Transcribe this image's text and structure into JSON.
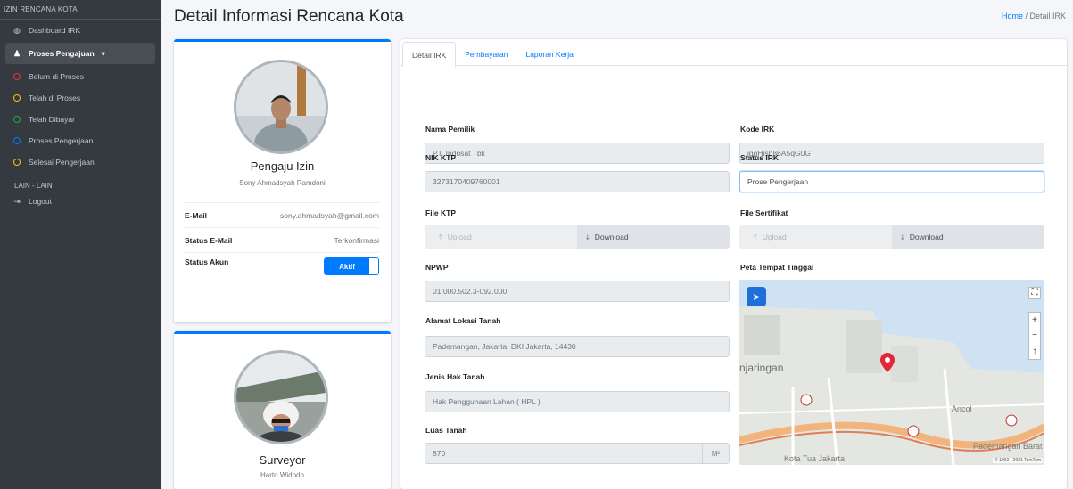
{
  "sidebar": {
    "brand": "IZIN RENCANA KOTA",
    "items": [
      {
        "label": "Dashboard IRK",
        "icon": "dashboard-icon"
      },
      {
        "label": "Proses Pengajuan",
        "icon": "user-icon"
      },
      {
        "label": "Belum di Proses",
        "color": "#dc3545"
      },
      {
        "label": "Telah di Proses",
        "color": "#ffc107"
      },
      {
        "label": "Telah Dibayar",
        "color": "#28a745"
      },
      {
        "label": "Proses Pengerjaan",
        "color": "#007bff"
      },
      {
        "label": "Selesai Pengerjaan",
        "color": "#ffc107"
      }
    ],
    "section": "LAIN - LAIN",
    "logout": "Logout"
  },
  "header": {
    "title": "Detail Informasi Rencana Kota",
    "breadcrumb_home": "Home",
    "breadcrumb_sep": " / ",
    "breadcrumb_current": "Detail IRK"
  },
  "applicant": {
    "role": "Pengaju Izin",
    "name": "Sony Ahmadsyah Ramdoni",
    "rows": [
      {
        "label": "E-Mail",
        "value": "sony.ahmadsyah@gmail.com"
      },
      {
        "label": "Status E-Mail",
        "value": "Terkonfirmasi"
      },
      {
        "label": "Status Akun",
        "value": "Aktif"
      }
    ]
  },
  "surveyor": {
    "role": "Surveyor",
    "name": "Harto Widodo"
  },
  "tabs": [
    "Detail IRK",
    "Pembayaran",
    "Laporan Kerja"
  ],
  "form": {
    "nama_pemilik": {
      "label": "Nama Pemilik",
      "value": "PT. Indosat Tbk"
    },
    "kode_irk": {
      "label": "Kode IRK",
      "value": "jgqHish86A5qG0G"
    },
    "nik_ktp": {
      "label": "NIK KTP",
      "value": "3273170409760001"
    },
    "status_irk": {
      "label": "Status IRK",
      "value": "Prose Pengerjaan"
    },
    "file_ktp": {
      "label": "File KTP",
      "upload": "Upload",
      "download": "Download"
    },
    "file_sertifikat": {
      "label": "File Sertifikat",
      "upload": "Upload",
      "download": "Download"
    },
    "npwp": {
      "label": "NPWP",
      "value": "01.000.502.3-092.000"
    },
    "peta": {
      "label": "Peta Tempat Tinggal"
    },
    "alamat": {
      "label": "Alamat Lokasi Tanah",
      "value": "Pademangan, Jakarta, DKI Jakarta, 14430"
    },
    "jenis_hak": {
      "label": "Jenis Hak Tanah",
      "value": "Hak Penggunaan Lahan ( HPL )"
    },
    "luas": {
      "label": "Luas Tanah",
      "value": "870",
      "unit": "M²"
    }
  },
  "map": {
    "place1": "njaringan",
    "place2": "Ancol",
    "place3": "Pademangan Barat",
    "place4": "Kota Tua Jakarta",
    "attribution": "© 1992 - 2021 TomTom"
  },
  "colors": {
    "sidebar_bg": "#343a40",
    "accent": "#007bff",
    "marker": "#e0283a"
  }
}
